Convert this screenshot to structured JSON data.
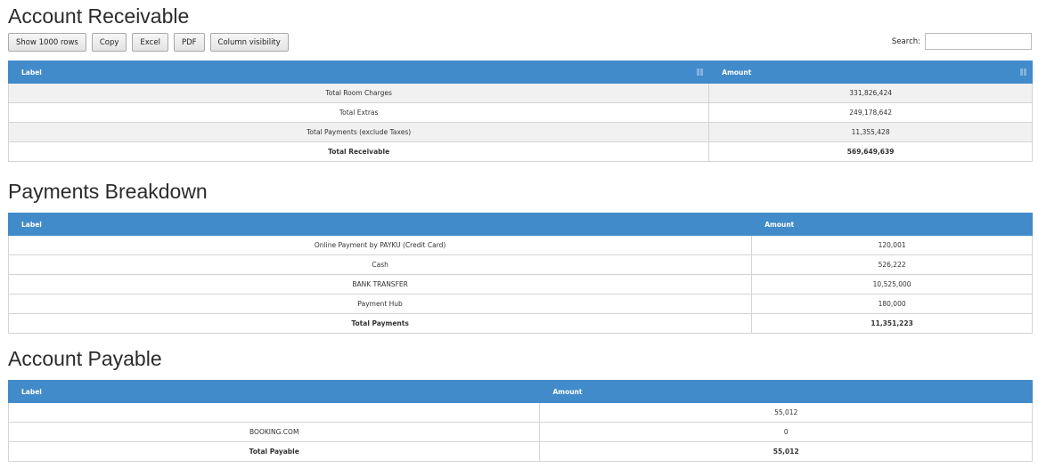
{
  "receivable": {
    "title": "Account Receivable",
    "buttons": [
      "Show 1000 rows",
      "Copy",
      "Excel",
      "PDF",
      "Column visibility"
    ],
    "search_label": "Search:",
    "search_value": "",
    "headers": [
      "Label",
      "Amount"
    ],
    "rows": [
      {
        "label": "Total Room Charges",
        "amount": "331,826,424"
      },
      {
        "label": "Total Extras",
        "amount": "249,178,642"
      },
      {
        "label": "Total Payments (exclude Taxes)",
        "amount": "11,355,428"
      },
      {
        "label": "Total Receivable",
        "amount": "569,649,639"
      }
    ]
  },
  "payments": {
    "title": "Payments Breakdown",
    "headers": [
      "Label",
      "Amount"
    ],
    "rows": [
      {
        "label": "Online Payment by PAYKU (Credit Card)",
        "amount": "120,001"
      },
      {
        "label": "Cash",
        "amount": "526,222"
      },
      {
        "label": "BANK TRANSFER",
        "amount": "10,525,000"
      },
      {
        "label": "Payment Hub",
        "amount": "180,000"
      },
      {
        "label": "Total Payments",
        "amount": "11,351,223"
      }
    ]
  },
  "payable": {
    "title": "Account Payable",
    "headers": [
      "Label",
      "Amount"
    ],
    "rows": [
      {
        "label": "",
        "amount": "55,012"
      },
      {
        "label": "BOOKING.COM",
        "amount": "0"
      },
      {
        "label": "Total Payable",
        "amount": "55,012"
      }
    ]
  },
  "colors": {
    "header_bg": "#428bca",
    "row_shade": "#f1f1f1"
  }
}
